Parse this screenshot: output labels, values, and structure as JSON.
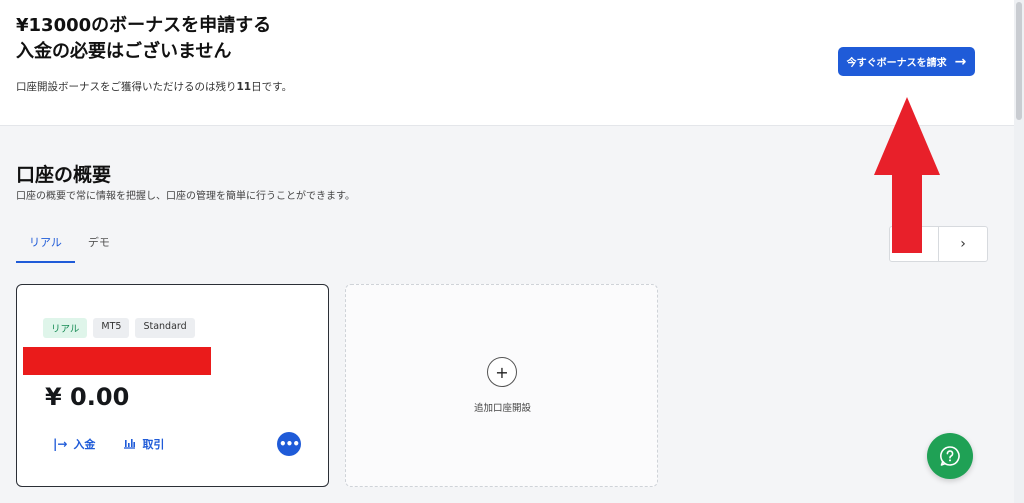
{
  "banner": {
    "title_line1": "¥13000のボーナスを申請する",
    "title_line2": "入金の必要はございません",
    "subtitle_prefix": "口座開設ボーナスをご獲得いただけるのは残り",
    "subtitle_days": "11",
    "subtitle_suffix": "日です。",
    "cta_label": "今すぐボーナスを請求",
    "cta_icon": "arrow-right-icon"
  },
  "overview": {
    "title": "口座の概要",
    "subtitle": "口座の概要で常に情報を把握し、口座の管理を簡単に行うことができます。",
    "tabs": [
      {
        "label": "リアル",
        "active": true
      },
      {
        "label": "デモ",
        "active": false
      }
    ],
    "nav": {
      "prev": "‹",
      "next": "›"
    }
  },
  "account_card": {
    "badges": [
      "リアル",
      "MT5",
      "Standard"
    ],
    "balance": "¥ 0.00",
    "deposit_label": "入金",
    "trade_label": "取引",
    "more_icon": "more-dots-icon"
  },
  "add_card": {
    "icon": "+",
    "label": "追加口座開設"
  },
  "colors": {
    "accent": "#1f5bd8",
    "real_badge": "#168a53",
    "annotation": "#e8202a",
    "help": "#1fa155"
  }
}
